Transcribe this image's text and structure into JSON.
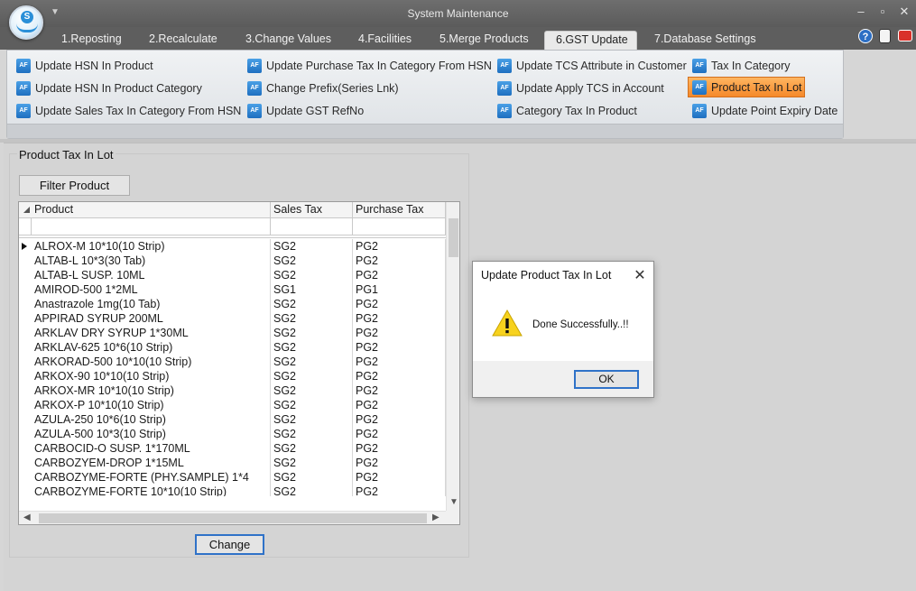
{
  "window": {
    "title": "System Maintenance",
    "controls": {
      "minimize": "–",
      "restore": "▫",
      "close": "✕"
    }
  },
  "tabs": [
    {
      "label": "1.Reposting"
    },
    {
      "label": "2.Recalculate"
    },
    {
      "label": "3.Change Values"
    },
    {
      "label": "4.Facilities"
    },
    {
      "label": "5.Merge Products"
    },
    {
      "label": "6.GST Update",
      "active": true
    },
    {
      "label": "7.Database Settings"
    }
  ],
  "ribbon": {
    "items": [
      {
        "label": "Update HSN In Product"
      },
      {
        "label": "Update HSN In Product Category"
      },
      {
        "label": "Update Sales Tax In Category From HSN"
      },
      {
        "label": "Update Purchase Tax In Category From HSN"
      },
      {
        "label": "Change Prefix(Series Lnk)"
      },
      {
        "label": "Update GST RefNo"
      },
      {
        "label": "Update TCS Attribute in Customer"
      },
      {
        "label": "Update Apply TCS in Account"
      },
      {
        "label": "Category Tax In Product"
      },
      {
        "label": "Tax In Category"
      },
      {
        "label": "Product Tax In Lot",
        "selected": true
      },
      {
        "label": "Update Point Expiry Date"
      }
    ]
  },
  "panel": {
    "title": "Product Tax In Lot",
    "filter_button": "Filter Product",
    "change_button": "Change"
  },
  "grid": {
    "columns": [
      "Product",
      "Sales Tax",
      "Purchase Tax"
    ],
    "rows": [
      [
        "ALROX-M 10*10(10 Strip)",
        "SG2",
        "PG2"
      ],
      [
        "ALTAB-L 10*3(30 Tab)",
        "SG2",
        "PG2"
      ],
      [
        "ALTAB-L SUSP. 10ML",
        "SG2",
        "PG2"
      ],
      [
        "AMIROD-500 1*2ML",
        "SG1",
        "PG1"
      ],
      [
        "Anastrazole 1mg(10 Tab)",
        "SG2",
        "PG2"
      ],
      [
        "APPIRAD SYRUP 200ML",
        "SG2",
        "PG2"
      ],
      [
        "ARKLAV DRY SYRUP 1*30ML",
        "SG2",
        "PG2"
      ],
      [
        "ARKLAV-625 10*6(10 Strip)",
        "SG2",
        "PG2"
      ],
      [
        "ARKORAD-500 10*10(10 Strip)",
        "SG2",
        "PG2"
      ],
      [
        "ARKOX-90 10*10(10 Strip)",
        "SG2",
        "PG2"
      ],
      [
        "ARKOX-MR 10*10(10 Strip)",
        "SG2",
        "PG2"
      ],
      [
        "ARKOX-P 10*10(10 Strip)",
        "SG2",
        "PG2"
      ],
      [
        "AZULA-250 10*6(10 Strip)",
        "SG2",
        "PG2"
      ],
      [
        "AZULA-500 10*3(10 Strip)",
        "SG2",
        "PG2"
      ],
      [
        "CARBOCID-O SUSP. 1*170ML",
        "SG2",
        "PG2"
      ],
      [
        "CARBOZYEM-DROP 1*15ML",
        "SG2",
        "PG2"
      ],
      [
        "CARBOZYME-FORTE (PHY.SAMPLE) 1*4",
        "SG2",
        "PG2"
      ],
      [
        "CARBOZYME-FORTE 10*10(10 Strip)",
        "SG2",
        "PG2"
      ]
    ]
  },
  "dialog": {
    "title": "Update Product Tax In Lot",
    "message": "Done Successfully..!!",
    "ok": "OK",
    "close": "✕"
  },
  "colors": {
    "title_bar": "#5b5b5b",
    "ribbon_selected": "#f5892a",
    "focus_border": "#2f72c8"
  }
}
